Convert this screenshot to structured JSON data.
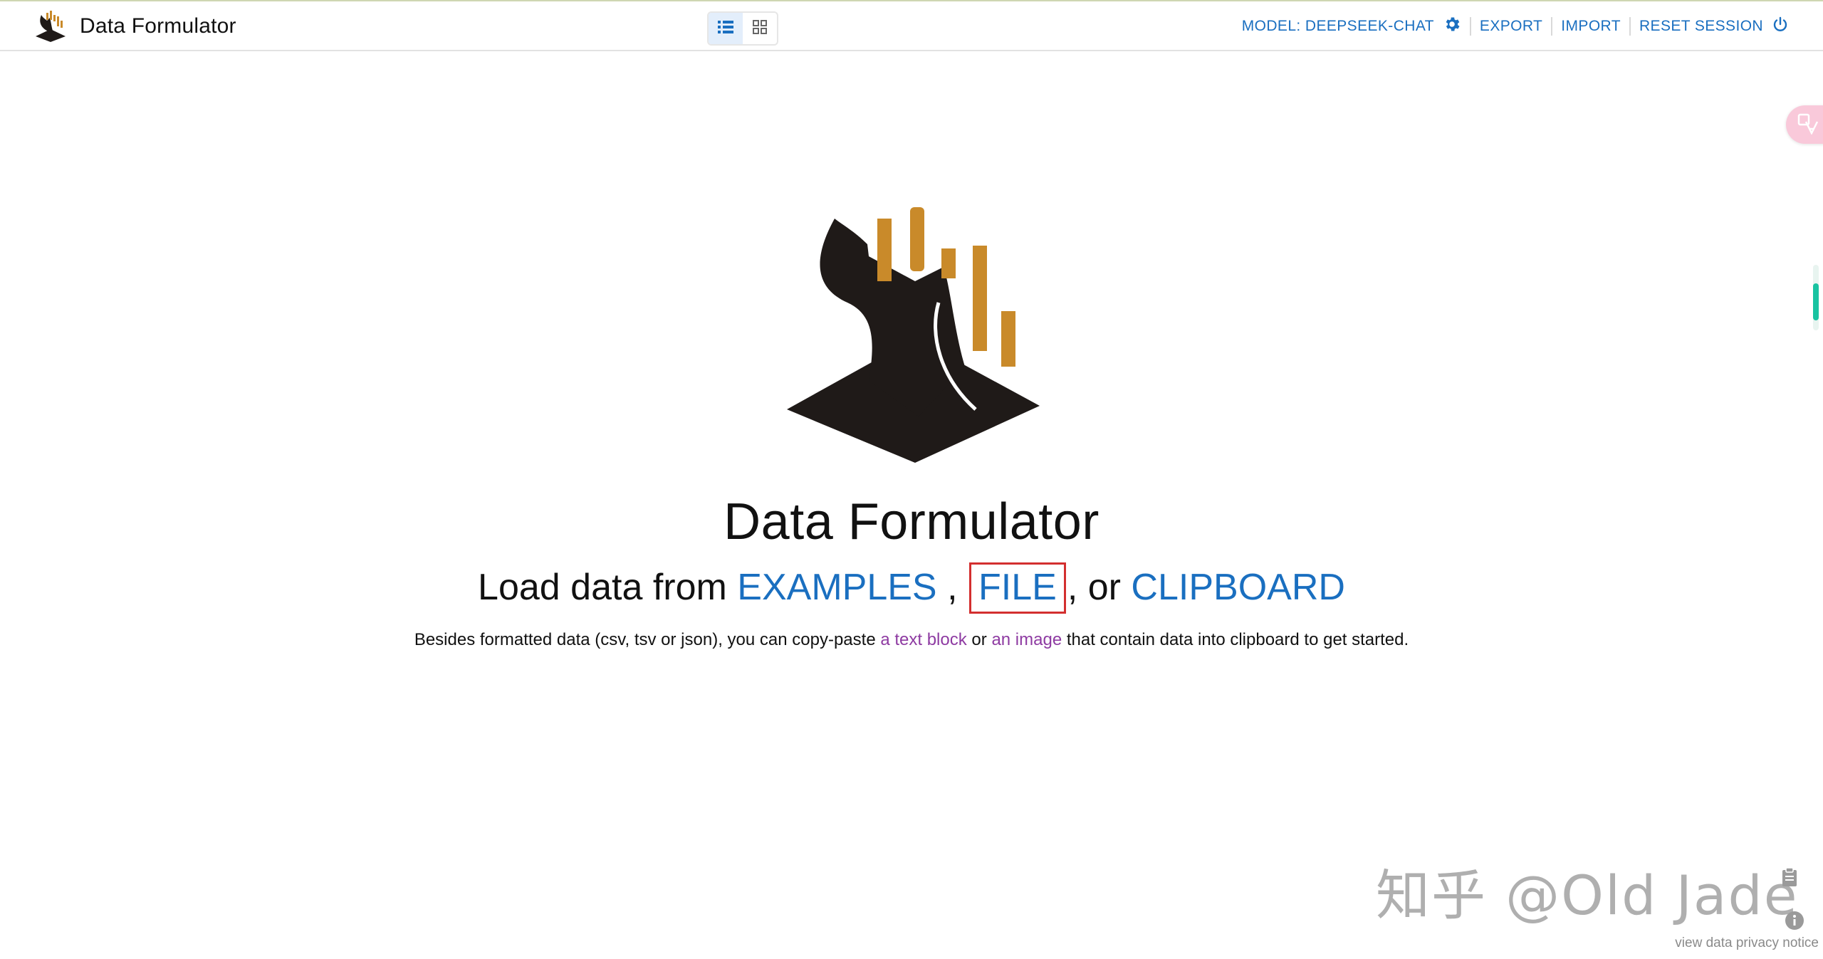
{
  "app": {
    "title": "Data Formulator"
  },
  "header": {
    "view_modes": [
      {
        "icon": "list-view-icon",
        "active": true
      },
      {
        "icon": "grid-view-icon",
        "active": false
      }
    ],
    "model_label": "MODEL: DEEPSEEK-CHAT",
    "export_label": "EXPORT",
    "import_label": "IMPORT",
    "reset_label": "RESET SESSION"
  },
  "hero": {
    "title": "Data Formulator",
    "load_prefix": "Load data from",
    "examples_link": "EXAMPLES",
    "sep1": " ,",
    "file_link": "FILE",
    "sep2": ", or",
    "clipboard_link": "CLIPBOARD",
    "helper_prefix": "Besides formatted data (csv, tsv or json), you can copy-paste",
    "helper_link1": "a text block",
    "helper_mid": "or",
    "helper_link2": "an image",
    "helper_suffix": "that contain data into clipboard to get started."
  },
  "watermark": {
    "text": "知乎 @Old Jade"
  },
  "footer": {
    "privacy_link": "view data privacy notice"
  },
  "colors": {
    "link_blue": "#1a6fc0",
    "link_purple": "#8e3ba2",
    "highlight_red": "#d32f2f",
    "logo_gold": "#c98a2a",
    "logo_dark": "#1f1a18"
  }
}
